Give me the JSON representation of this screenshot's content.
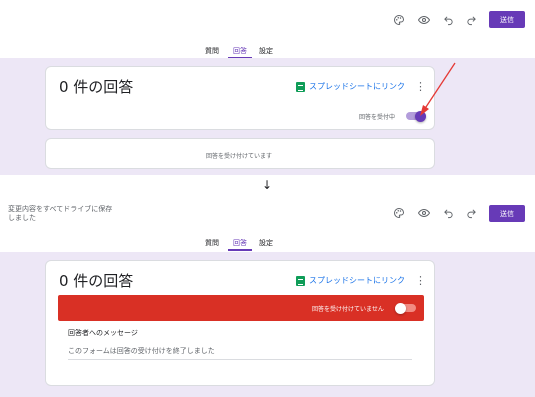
{
  "before": {
    "toolbar": {
      "icons": [
        "palette-icon",
        "eye-icon",
        "undo-icon",
        "redo-icon"
      ],
      "send_label": "送信"
    },
    "tabs": [
      {
        "label": "質問",
        "active": false
      },
      {
        "label": "回答",
        "active": true
      },
      {
        "label": "設定",
        "active": false
      }
    ],
    "summary": {
      "count_title": "0 件の回答",
      "sheets_link": "スプレッドシートにリンク",
      "accepting_label": "回答を受付中",
      "accepting": true
    },
    "status_message": "回答を受け付けています"
  },
  "transition_arrow": "↓",
  "after": {
    "toolbar": {
      "saved_note": "変更内容をすべてドライブに保存しました",
      "icons": [
        "palette-icon",
        "eye-icon",
        "undo-icon",
        "redo-icon"
      ],
      "send_label": "送信"
    },
    "tabs": [
      {
        "label": "質問",
        "active": false
      },
      {
        "label": "回答",
        "active": true
      },
      {
        "label": "設定",
        "active": false
      }
    ],
    "summary": {
      "count_title": "0 件の回答",
      "sheets_link": "スプレッドシートにリンク",
      "not_accepting_label": "回答を受け付けていません",
      "accepting": false
    },
    "message": {
      "label": "回答者へのメッセージ",
      "value": "このフォームは回答の受け付けを終了しました"
    }
  },
  "colors": {
    "accent": "#673ab7",
    "background": "#ede7f6",
    "banner_red": "#d93025",
    "annotation_red": "#e53935"
  }
}
